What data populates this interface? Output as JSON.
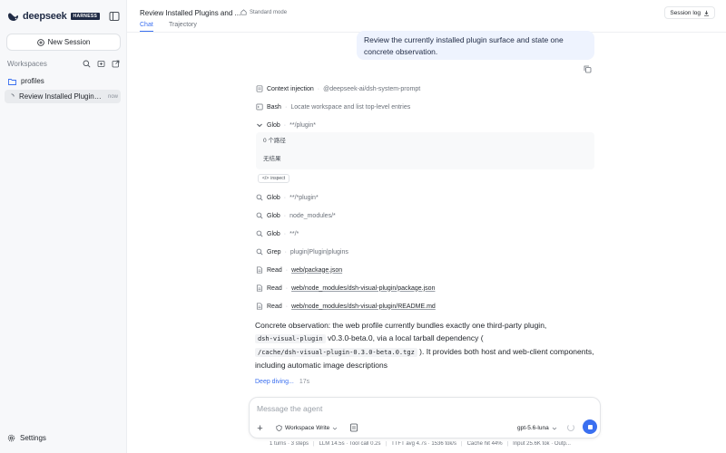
{
  "sidebar": {
    "brand_name": "deepseek",
    "brand_badge": "HARNESS",
    "new_session_label": "New Session",
    "workspaces_label": "Workspaces",
    "workspaces": [
      {
        "label": "profiles"
      },
      {
        "label": "Review Installed Plugins and...",
        "time": "now"
      }
    ],
    "settings_label": "Settings"
  },
  "header": {
    "title": "Review Installed Plugins and ...",
    "mode": "Standard mode",
    "tabs": [
      "Chat",
      "Trajectory"
    ],
    "active_tab": "Chat",
    "session_log_label": "Session log"
  },
  "conversation": {
    "user_message": "Review the currently installed plugin surface and state one concrete observation.",
    "steps": [
      {
        "tool": "Context injection",
        "arg": "@deepseek-ai/dsh-system-prompt",
        "icon": "document-icon"
      },
      {
        "tool": "Bash",
        "arg": "Locate workspace and list top-level entries",
        "icon": "terminal-icon"
      },
      {
        "tool": "Glob",
        "arg": "**/plugin*",
        "icon": "chevron-down-icon"
      },
      {
        "tool": "Glob",
        "arg": "**/*plugin*",
        "icon": "search-icon"
      },
      {
        "tool": "Glob",
        "arg": "node_modules/*",
        "icon": "search-icon"
      },
      {
        "tool": "Glob",
        "arg": "**/*",
        "icon": "search-icon"
      },
      {
        "tool": "Grep",
        "arg": "plugin|Plugin|plugins",
        "icon": "search-icon"
      },
      {
        "tool": "Read",
        "arg": "web/package.json",
        "icon": "file-icon"
      },
      {
        "tool": "Read",
        "arg": "web/node_modules/dsh-visual-plugin/package.json",
        "icon": "file-icon"
      },
      {
        "tool": "Read",
        "arg": "web/node_modules/dsh-visual-plugin/README.md",
        "icon": "file-icon"
      }
    ],
    "glob_result": {
      "line1": "0 个路径",
      "line2": "无结果"
    },
    "inspect_label": "inspect",
    "answer": {
      "p1": "Concrete observation: the web profile currently bundles exactly one third-party plugin,",
      "code1": "dsh-visual-plugin",
      "p2": " v0.3.0-beta.0, via a local tarball dependency (",
      "code2": "/cache/dsh-visual-plugin-0.3.0-beta.0.tgz",
      "p3": " ). It provides both host and web-client components, including automatic image descriptions"
    },
    "deep_dive_label": "Deep diving...",
    "deep_dive_time": "17s"
  },
  "composer": {
    "placeholder": "Message the agent",
    "permission": "Workspace Write",
    "model": "gpt-5.6-luna"
  },
  "status": {
    "items": [
      "1 turns · 3 steps",
      "LLM 14.5s · Tool call 0.2s",
      "TTFT avg 4.7s · 1536 tok/s",
      "Cache hit 44%",
      "Input 25.6K tok · Outp..."
    ]
  },
  "colors": {
    "accent": "#3a6ff0",
    "user_bubble": "#eef3fe",
    "brand": "#1f2a44"
  }
}
